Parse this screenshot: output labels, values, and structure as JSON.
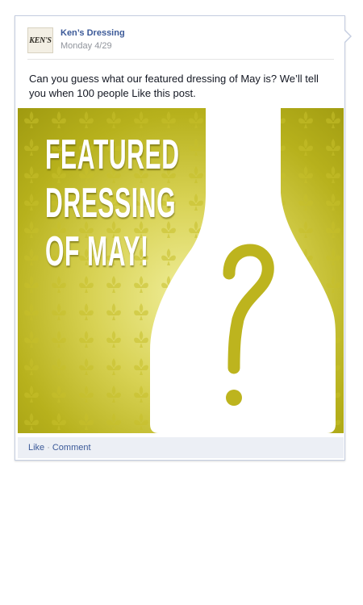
{
  "post": {
    "page_name": "Ken’s Dressing",
    "date": "Monday 4/29",
    "avatar_text": "KEN'S",
    "message": "Can you guess what our featured dressing of May is? We’ll tell you when 100 people Like this post.",
    "image": {
      "headline_lines": [
        "FEATURED",
        "DRESSING",
        "OF MAY!"
      ],
      "question_mark": "?",
      "colors": {
        "gold_dark": "#9f9a10",
        "gold_light": "#f0ee9a",
        "question": "#bdb41e",
        "bottle": "#ffffff"
      }
    },
    "actions": {
      "like": "Like",
      "separator": "·",
      "comment": "Comment"
    }
  }
}
